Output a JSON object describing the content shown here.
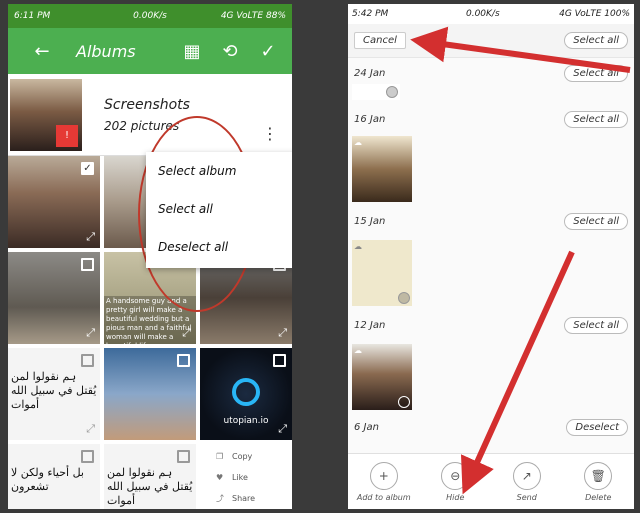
{
  "left_phone": {
    "status": {
      "time": "6:11 PM",
      "speed": "0.00K/s",
      "signal": "4G VoLTE",
      "battery": "88%"
    },
    "appbar": {
      "title": "Albums",
      "back_glyph": "←",
      "grid_glyph": "▦",
      "history_glyph": "⟲",
      "check_glyph": "✓"
    },
    "album": {
      "name": "Screenshots",
      "count": "202 pictures",
      "badge": "!"
    },
    "menu": {
      "items": [
        "Select album",
        "Select all",
        "Deselect all"
      ]
    },
    "grid_text": {
      "urdu_1": "ہم نقولوا لمن يُقتل في سبيل الله أموات",
      "urdu_2": "بل أحياء ولكن لا تشعرون",
      "caption": "A handsome guy and a pretty girl will make a beautiful wedding but a pious man and a faithful woman will make a beautiful life",
      "logo": "utopian.io"
    },
    "mini_menu": [
      "Copy",
      "Like",
      "Share"
    ]
  },
  "right_phone": {
    "status": {
      "time": "5:42 PM",
      "speed": "0.00K/s",
      "signal": "4G VoLTE",
      "battery": "100%"
    },
    "top": {
      "cancel": "Cancel",
      "select_all": "Select all"
    },
    "sections": [
      {
        "date": "24 Jan",
        "action": "Select all"
      },
      {
        "date": "16 Jan",
        "action": "Select all"
      },
      {
        "date": "15 Jan",
        "action": "Select all"
      },
      {
        "date": "12 Jan",
        "action": "Select all"
      },
      {
        "date": "6 Jan",
        "action": "Deselect"
      }
    ],
    "bottom": [
      {
        "icon": "+",
        "label": "Add to album"
      },
      {
        "icon": "⊖",
        "label": "Hide"
      },
      {
        "icon": "↗",
        "label": "Send"
      },
      {
        "icon": "🗑",
        "label": "Delete"
      }
    ]
  },
  "colors": {
    "appbar": "#4caf50",
    "annotation_red": "#d32f2f"
  }
}
